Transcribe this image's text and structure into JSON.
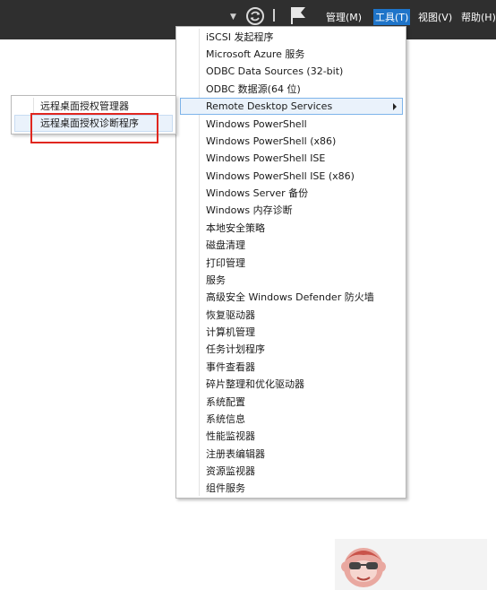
{
  "menubar": {
    "items": [
      {
        "label": "管理(M)",
        "active": false
      },
      {
        "label": "工具(T)",
        "active": true
      },
      {
        "label": "视图(V)",
        "active": false
      },
      {
        "label": "帮助(H)",
        "active": false
      }
    ]
  },
  "tools_menu": {
    "items": [
      {
        "label": "iSCSI 发起程序"
      },
      {
        "label": "Microsoft Azure 服务"
      },
      {
        "label": "ODBC Data Sources (32-bit)"
      },
      {
        "label": "ODBC 数据源(64 位)"
      },
      {
        "label": "Remote Desktop Services",
        "has_submenu": true,
        "highlighted": true
      },
      {
        "label": "Windows PowerShell"
      },
      {
        "label": "Windows PowerShell (x86)"
      },
      {
        "label": "Windows PowerShell ISE"
      },
      {
        "label": "Windows PowerShell ISE (x86)"
      },
      {
        "label": "Windows Server 备份"
      },
      {
        "label": "Windows 内存诊断"
      },
      {
        "label": "本地安全策略"
      },
      {
        "label": "磁盘清理"
      },
      {
        "label": "打印管理"
      },
      {
        "label": "服务"
      },
      {
        "label": "高级安全 Windows Defender 防火墙"
      },
      {
        "label": "恢复驱动器"
      },
      {
        "label": "计算机管理"
      },
      {
        "label": "任务计划程序"
      },
      {
        "label": "事件查看器"
      },
      {
        "label": "碎片整理和优化驱动器"
      },
      {
        "label": "系统配置"
      },
      {
        "label": "系统信息"
      },
      {
        "label": "性能监视器"
      },
      {
        "label": "注册表编辑器"
      },
      {
        "label": "资源监视器"
      },
      {
        "label": "组件服务"
      }
    ]
  },
  "rds_submenu": {
    "items": [
      {
        "label": "远程桌面授权管理器"
      },
      {
        "label": "远程桌面授权诊断程序",
        "hovered": true
      }
    ]
  },
  "icons": {
    "dropdown_caret": "dropdown-caret-icon",
    "refresh": "refresh-icon",
    "flag": "notification-flag-icon",
    "submenu_arrow": "submenu-arrow-icon"
  },
  "colors": {
    "topbar": "#2f2f2f",
    "active_menu": "#1e74c9",
    "highlight_border": "#7eb4ea",
    "annotation_red": "#e0271f"
  }
}
